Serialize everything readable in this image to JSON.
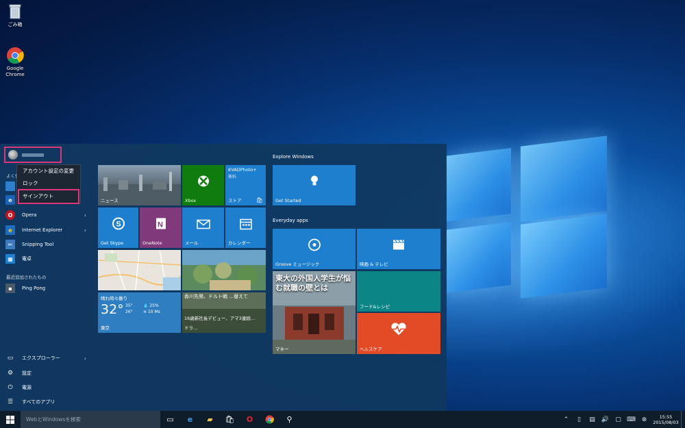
{
  "desktop": {
    "icons": [
      {
        "label": "ごみ箱",
        "icon": "recycle-bin-icon"
      },
      {
        "label": "Google Chrome",
        "icon": "chrome-icon"
      }
    ]
  },
  "start_menu": {
    "context_menu": {
      "items": [
        "アカウント設定の変更",
        "ロック",
        "サインアウト"
      ]
    },
    "sections": {
      "most_used_fragment": "よく使",
      "recently_added": "最近追加されたもの"
    },
    "apps": [
      {
        "label": "Opera",
        "has_arrow": true
      },
      {
        "label": "Internet Explorer",
        "has_arrow": true
      },
      {
        "label": "Snipping Tool",
        "has_arrow": false
      },
      {
        "label": "電卓",
        "has_arrow": false
      }
    ],
    "recent_apps": [
      {
        "label": "Ping Pong"
      }
    ],
    "bottom": [
      {
        "label": "エクスプローラー",
        "icon": "folder-icon",
        "has_arrow": true
      },
      {
        "label": "設定",
        "icon": "gear-icon"
      },
      {
        "label": "電源",
        "icon": "power-icon"
      },
      {
        "label": "すべてのアプリ",
        "icon": "list-icon"
      }
    ],
    "tiles": {
      "news": "ニュース",
      "xbox": "Xbox",
      "store": {
        "title": "KVADPhoto+",
        "subtitle": "無料",
        "label": "ストア"
      },
      "skype": "Get Skype",
      "onenote": "OneNote",
      "mail": "メール",
      "calendar": "カレンダー",
      "weather": {
        "condition": "晴れ時々曇り",
        "temp": "32°",
        "high": "35°",
        "low": "26°",
        "precip": "25%",
        "wind": "10 Ms",
        "city": "東京"
      },
      "photo_headline": "香川先発、ドルト戦 …替えて",
      "news2_headline": "16歳新社長デビュー、アマ3連続…",
      "news2_sub": "ドラ…",
      "explore_title": "Explore Windows",
      "get_started": "Get Started",
      "everyday_title": "Everyday apps",
      "groove": "Groove ミュージック",
      "movies": "映画 & テレビ",
      "money_headline": "東大の外国人学生が悩む就職の壁とは",
      "money": "マネー",
      "food": "フード&レシピ",
      "health": "ヘルスケア"
    }
  },
  "taskbar": {
    "search_placeholder": "WebとWindowsを検索",
    "time": "15:55",
    "date": "2015/08/03"
  },
  "colors": {
    "accent_pink": "#e0357a",
    "tile_blue": "#1e7fcf",
    "xbox_green": "#107c10",
    "onenote_purple": "#80397b",
    "health_red": "#e24b26",
    "food_teal": "#0b8585"
  }
}
